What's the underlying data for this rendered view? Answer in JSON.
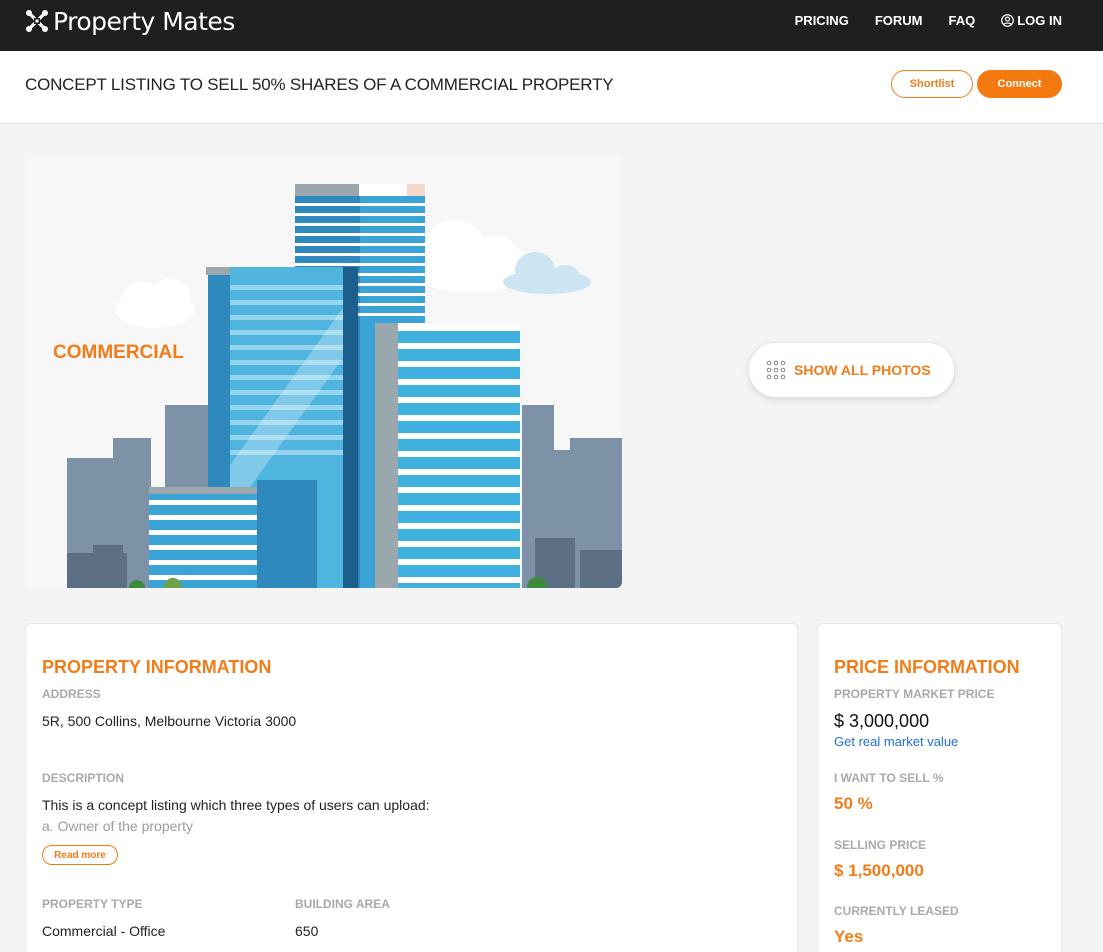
{
  "brand": {
    "name": "Property Mates",
    "logo": "property-mates-logo"
  },
  "nav": {
    "items": [
      {
        "label": "PRICING"
      },
      {
        "label": "FORUM"
      },
      {
        "label": "FAQ"
      },
      {
        "label": "LOG IN",
        "icon": "user-circle-icon"
      }
    ]
  },
  "listing": {
    "title": "CONCEPT LISTING TO SELL 50% SHARES OF A COMMERCIAL PROPERTY",
    "shortlist_label": "Shortlist",
    "connect_label": "Connect"
  },
  "hero": {
    "badge_text": "COMMERCIAL",
    "show_photos_label": "SHOW ALL PHOTOS",
    "show_photos_icon": "grid-dots-icon"
  },
  "property_info": {
    "heading": "PROPERTY INFORMATION",
    "address_label": "ADDRESS",
    "address": "5R, 500 Collins, Melbourne Victoria 3000",
    "description_label": "DESCRIPTION",
    "description_line1": "This is a concept listing which three types of users can upload:",
    "description_line2": "a. Owner of the property",
    "read_more_label": "Read more",
    "type_label": "PROPERTY TYPE",
    "type_value": "Commercial - Office",
    "area_label": "BUILDING AREA",
    "area_value": "650"
  },
  "price_info": {
    "heading": "PRICE INFORMATION",
    "market_price_label": "PROPERTY MARKET PRICE",
    "market_price": "$ 3,000,000",
    "market_value_link": "Get real market value",
    "sell_pct_label": "I WANT TO SELL %",
    "sell_pct": "50 %",
    "selling_price_label": "SELLING PRICE",
    "selling_price": "$ 1,500,000",
    "leased_label": "CURRENTLY LEASED",
    "leased": "Yes"
  },
  "colors": {
    "accent": "#f07d1a",
    "nav_bg": "#1f1f1f",
    "link": "#1f6fd6"
  }
}
